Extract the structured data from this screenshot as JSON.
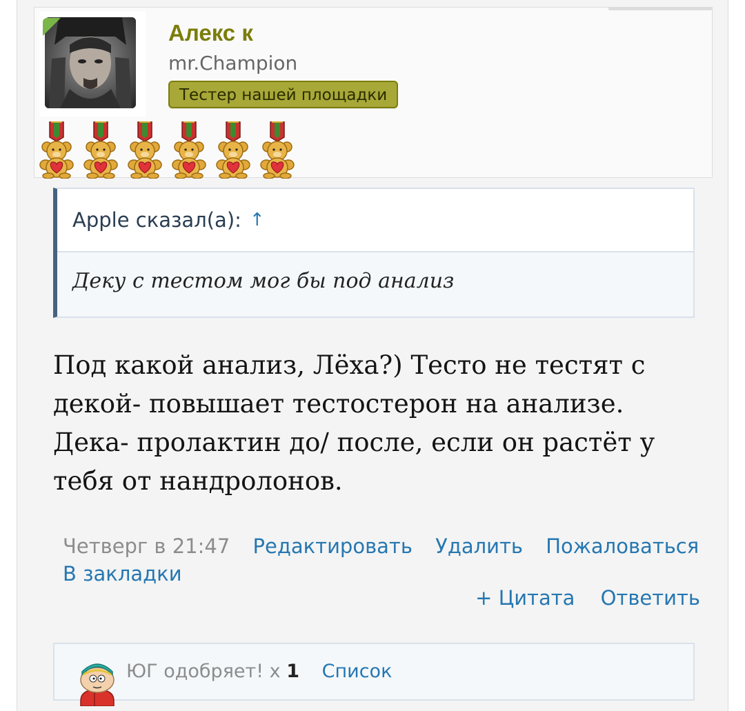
{
  "user": {
    "name": "Алекс к",
    "title": "mr.Champion",
    "banner": "Тестер нашей площадки",
    "online_color": "#7ab648",
    "award_count": 6,
    "award_icon": "teddy-bear-medal-icon"
  },
  "quote": {
    "author": "Apple сказал(а):",
    "jump_icon": "↑",
    "text": "Деку с тестом мог бы под анализ"
  },
  "message": {
    "lines": [
      "Под какой анализ, Лёха?) Тесто не тестят с",
      "декой- повышает тестостерон на анализе.",
      "Дека- пролактин до/ после, если он растёт у",
      "тебя от нандролонов."
    ]
  },
  "meta": {
    "date": "Четверг в 21:47",
    "edit": "Редактировать",
    "delete": "Удалить",
    "report": "Пожаловаться",
    "bookmark": "В закладки",
    "multiquote": "+ Цитата",
    "reply": "Ответить"
  },
  "likes": {
    "text": "ЮГ одобряет! x",
    "count": "1",
    "list": "Список"
  },
  "colors": {
    "username": "#7b7d0a",
    "banner_bg": "#a7a837",
    "link": "#2577b1",
    "quote_border": "#45637f"
  }
}
